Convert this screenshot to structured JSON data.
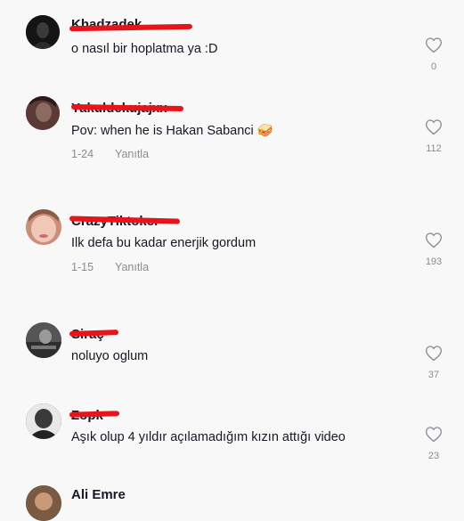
{
  "comments": [
    {
      "username": "Khadzadek",
      "text": "o nasıl bir hoplatma ya :D",
      "date": "",
      "reply_label": "",
      "likes": "0",
      "avatar_color": "#1b1b1b"
    },
    {
      "username": "Yakuldekujajxx",
      "text": "Pov: when he is Hakan Sabanci",
      "emoji": "🥪",
      "date": "1-24",
      "reply_label": "Yanıtla",
      "likes": "112",
      "avatar_color": "#6b4a42"
    },
    {
      "username": "CrazyTiktoker",
      "text": "Ilk defa bu kadar enerjik gordum",
      "date": "1-15",
      "reply_label": "Yanıtla",
      "likes": "193",
      "avatar_color": "#e7b9a6"
    },
    {
      "username": "Siraç",
      "text": "noluyo oglum",
      "date": "",
      "reply_label": "",
      "likes": "37",
      "avatar_color": "#4a4a4a"
    },
    {
      "username": "Zopk",
      "text": "Aşık olup 4 yıldır açılamadığım kızın attığı video",
      "date": "",
      "reply_label": "",
      "likes": "23",
      "avatar_color": "#2c2c2c"
    },
    {
      "username": "Ali Emre",
      "text": "",
      "date": "",
      "reply_label": "",
      "likes": "",
      "avatar_color": "#5a4030"
    }
  ],
  "icons": {
    "like": "heart-outline-icon"
  },
  "colors": {
    "background": "#f8f8f8",
    "text": "#161823",
    "muted": "#8a8b91",
    "redaction": "#e8141b"
  }
}
